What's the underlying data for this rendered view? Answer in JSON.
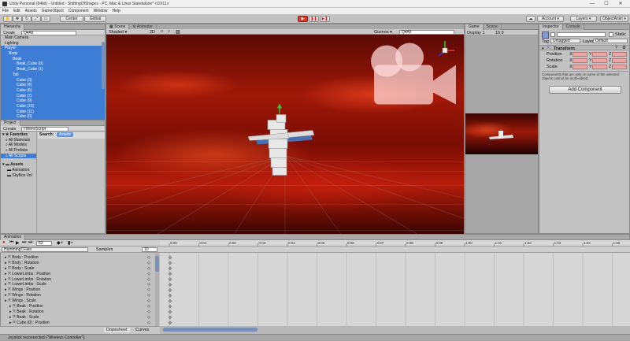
{
  "window": {
    "title": "Unity Personal (64bit) - Untitled - ShiftingOfShapes - PC, Mac & Linux Standalone* <DX11>",
    "controls": [
      "—",
      "☐",
      "✕"
    ]
  },
  "menu": [
    "File",
    "Edit",
    "Assets",
    "GameObject",
    "Component",
    "Window",
    "Help"
  ],
  "toolbar": {
    "pivot": "Center",
    "space": "Global",
    "account": "Account",
    "layers": "Layers",
    "layout": "ObjectAnim"
  },
  "hierarchy": {
    "tab": "Hierarchy",
    "create": "Create",
    "search_placeholder": "Q▾All",
    "items": [
      {
        "label": "Main Camera",
        "indent": 1,
        "selected": false
      },
      {
        "label": "Lighting",
        "indent": 1,
        "selected": false
      },
      {
        "label": "Player",
        "indent": 1,
        "selected": true
      },
      {
        "label": "Body",
        "indent": 2,
        "selected": true
      },
      {
        "label": "Beak",
        "indent": 3,
        "selected": true
      },
      {
        "label": "Beak_Cube (0)",
        "indent": 4,
        "selected": true
      },
      {
        "label": "Beak_Cube (1)",
        "indent": 4,
        "selected": true
      },
      {
        "label": "Tail",
        "indent": 3,
        "selected": true
      },
      {
        "label": "Cube (3)",
        "indent": 4,
        "selected": true
      },
      {
        "label": "Cube (4)",
        "indent": 4,
        "selected": true
      },
      {
        "label": "Cube (6)",
        "indent": 4,
        "selected": true
      },
      {
        "label": "Cube (7)",
        "indent": 4,
        "selected": true
      },
      {
        "label": "Cube (9)",
        "indent": 4,
        "selected": true
      },
      {
        "label": "Cube (10)",
        "indent": 4,
        "selected": true
      },
      {
        "label": "Cube (11)",
        "indent": 4,
        "selected": true
      },
      {
        "label": "Cube (0)",
        "indent": 4,
        "selected": true
      }
    ]
  },
  "project": {
    "tab": "Project",
    "create": "Create",
    "search_value": "t:MonoScript",
    "favorites_label": "Favorites",
    "favorites": [
      "All Materials",
      "All Models",
      "All Prefabs",
      "All Scripts"
    ],
    "search_label": "Search:",
    "search_scope": "Assets",
    "assets_label": "Assets",
    "assets": [
      "Animation",
      "SkyBox Vol"
    ]
  },
  "scene": {
    "tabs": [
      "Scene",
      "Animator"
    ],
    "shading": "Shaded",
    "mode2d": "2D",
    "gizmos": "Gizmos",
    "search": "Q▾All",
    "persp_label": "◄ Persp"
  },
  "game": {
    "tabs": [
      "Game",
      "Scene"
    ],
    "display": "Display 1",
    "aspect": "16:9"
  },
  "inspector": {
    "tabs": [
      "Inspector",
      "Console"
    ],
    "static_label": "Static",
    "tag_label": "Tag",
    "tag_value": "Untagged",
    "layer_label": "Layer",
    "layer_value": "Default",
    "component": "Transform",
    "rows": [
      "Position",
      "Rotation",
      "Scale"
    ],
    "axes": [
      "X",
      "Y",
      "Z"
    ],
    "note": "Components that are only on some of the selected objects cannot be multi-edited.",
    "add_component": "Add Component"
  },
  "animation": {
    "tab": "Animation",
    "frame": "63",
    "clip": "HummingTFlies",
    "samples_label": "Samples",
    "samples_value": "10",
    "properties": [
      {
        "label": "Body : Position",
        "indent": 0
      },
      {
        "label": "Body : Rotation",
        "indent": 0
      },
      {
        "label": "Body : Scale",
        "indent": 0
      },
      {
        "label": "LowerLimbs : Position",
        "indent": 0
      },
      {
        "label": "LowerLimbs : Rotation",
        "indent": 0
      },
      {
        "label": "LowerLimbs : Scale",
        "indent": 0
      },
      {
        "label": "Wings : Position",
        "indent": 0
      },
      {
        "label": "Wings : Rotation",
        "indent": 0
      },
      {
        "label": "Wings : Scale",
        "indent": 0
      },
      {
        "label": "Beak : Position",
        "indent": 1
      },
      {
        "label": "Beak : Rotation",
        "indent": 1
      },
      {
        "label": "Beak : Scale",
        "indent": 1
      },
      {
        "label": "Cube (0) : Position",
        "indent": 1
      }
    ],
    "ticks": [
      "0:00",
      "0:01",
      "0:02",
      "0:03",
      "0:04",
      "0:05",
      "0:06",
      "0:07",
      "0:08",
      "0:09",
      "1:00",
      "1:01",
      "1:02",
      "1:03",
      "1:04",
      "1:05"
    ],
    "dopesheet": "Dopesheet",
    "curves": "Curves"
  },
  "status": {
    "message": "Joystick reconnected (\"Wireless Controller\")."
  }
}
